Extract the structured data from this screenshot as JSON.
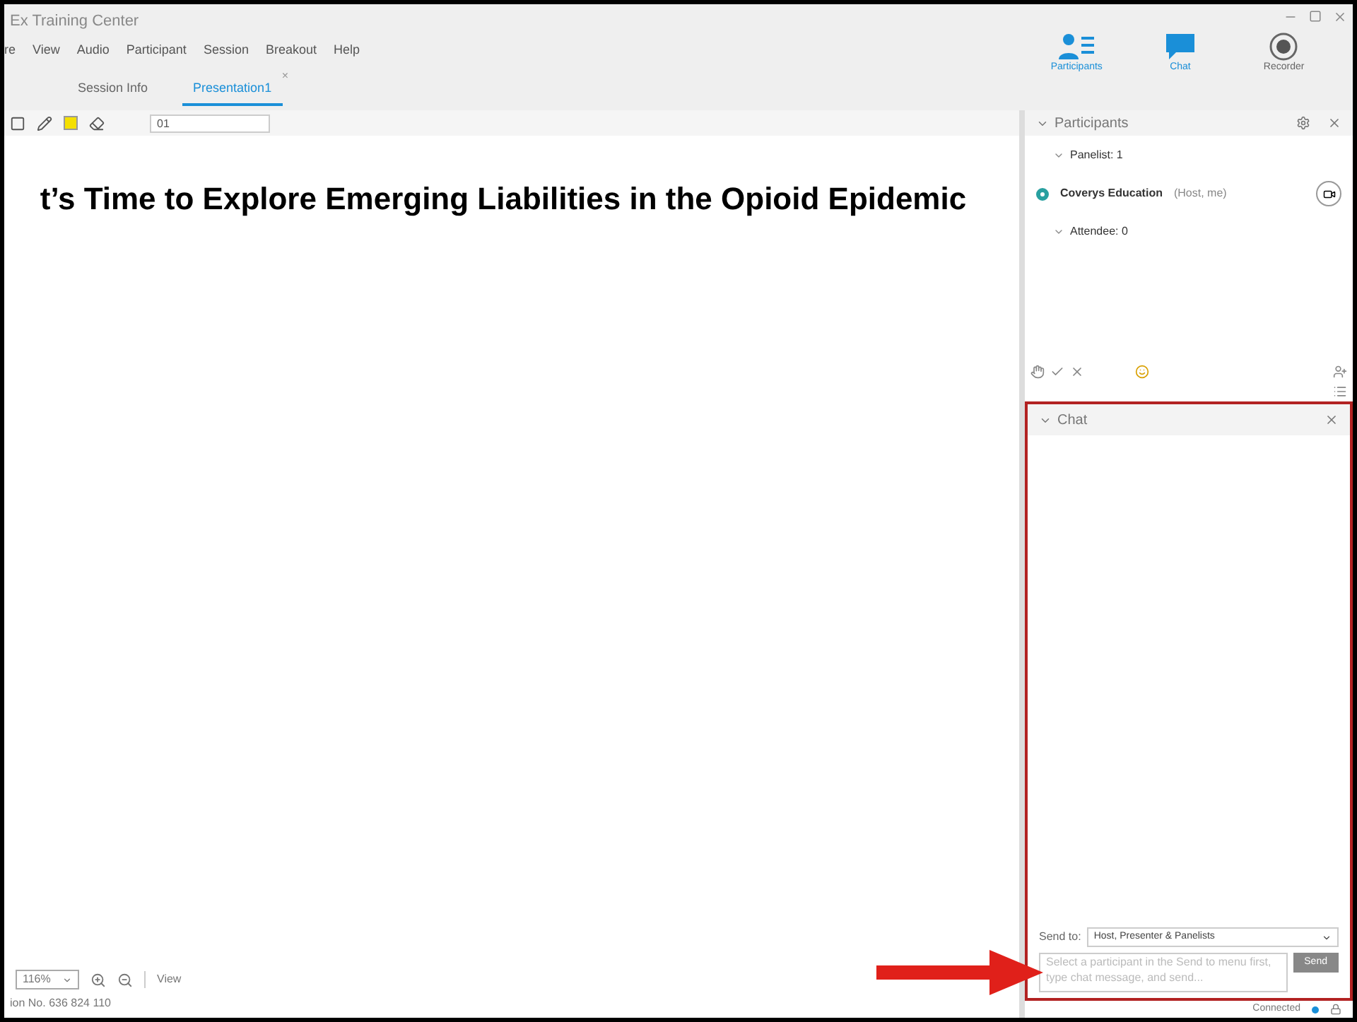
{
  "window": {
    "title": "Ex Training Center"
  },
  "menu": [
    "re",
    "View",
    "Audio",
    "Participant",
    "Session",
    "Breakout",
    "Help"
  ],
  "panel_buttons": [
    {
      "kind": "participants",
      "label": "Participants",
      "selected": true
    },
    {
      "kind": "chat",
      "label": "Chat",
      "selected": true
    },
    {
      "kind": "recorder",
      "label": "Recorder",
      "selected": false
    }
  ],
  "tabs": [
    {
      "label": "Session Info",
      "selected": false
    },
    {
      "label": "Presentation1",
      "selected": true,
      "close": "×"
    }
  ],
  "toolbar": {
    "page": "01"
  },
  "slide": {
    "title": "t’s Time to Explore Emerging Liabilities in the Opioid Epidemic"
  },
  "zoom": {
    "value": "116%",
    "view": "View"
  },
  "status": {
    "session": "ion No. 636 824 110",
    "connection": "Connected"
  },
  "participants": {
    "title": "Participants",
    "groups": [
      {
        "label": "Panelist: 1",
        "expanded": true,
        "members": [
          {
            "name": "Coverys Education",
            "role": "(Host, me)"
          }
        ]
      },
      {
        "label": "Attendee: 0",
        "expanded": true
      }
    ]
  },
  "chat": {
    "title": "Chat",
    "send_to_label": "Send to:",
    "send_to": "Host, Presenter & Panelists",
    "placeholder": "Select a participant in the Send to menu first, type chat message, and send...",
    "send": "Send"
  }
}
